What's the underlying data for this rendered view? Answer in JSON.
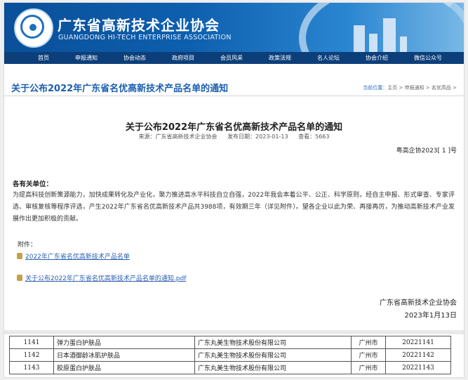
{
  "header": {
    "title_cn": "广东省高新技术企业协会",
    "title_en": "GUANGDONG HI-TECH ENTERPRISE ASSOCIATION"
  },
  "nav": [
    "首页",
    "申报通知",
    "协会动态",
    "政府项目",
    "会员风采",
    "政策法规",
    "名人论坛",
    "协会介绍",
    "微信公众号"
  ],
  "page_title": "关于公布2022年广东省名优高新技术产品名单的通知",
  "breadcrumb": {
    "label": "当前位置：",
    "path": "主页 > 申报通知 > 名优高品 >"
  },
  "article": {
    "title": "关于公布2022年广东省名优高新技术产品名单的通知",
    "source": "来源：广东省高新技术企业协会",
    "date": "发布日期：2023-01-13",
    "views": "查看：5663",
    "doc_no": "粤高企协2023[ 1 ]号",
    "salutation": "各有关单位：",
    "body": "为提高科技创新策源能力，加快成果转化及产业化，聚力推进高水平科技自立自强，2022年我会本着公平、公正、科学原则，经自主申报、形式审查、专家评选、审核复核等程序评选，产生2022年广东省名优高新技术产品共3988项，有效期三年（详见附件）。望各企业以此为荣、再接再厉，为推动高新技术产业发展作出更加积极的贡献。",
    "attachments_label": "附件：",
    "attachments": [
      "2022年广东省名优高新技术产品名单",
      "关于公布2022年广东省名优高新技术产品名单的通知.pdf"
    ],
    "sign_org": "广东省高新技术企业协会",
    "sign_date": "2023年1月13日"
  },
  "table_rows": [
    [
      "1141",
      "弹力蛋白护肤品",
      "广东丸美生物技术股份有限公司",
      "广州市",
      "20221141"
    ],
    [
      "1142",
      "日本酒御龄冰肌护肤品",
      "广东丸美生物技术股份有限公司",
      "广州市",
      "20221142"
    ],
    [
      "1143",
      "胶原蛋白护肤品",
      "广东丸美生物技术股份有限公司",
      "广州市",
      "20221143"
    ]
  ]
}
